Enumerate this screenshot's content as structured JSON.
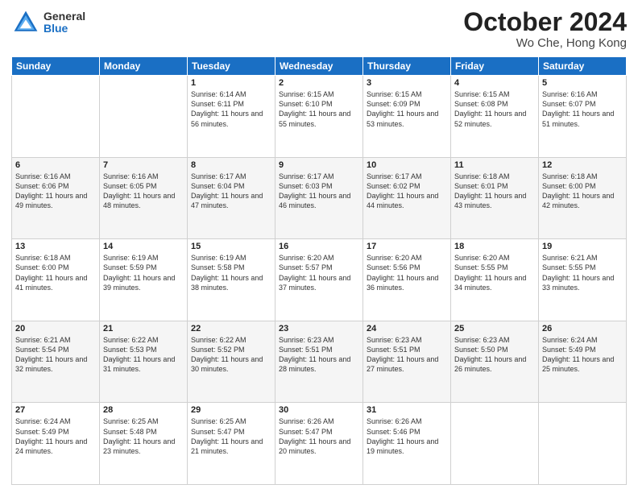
{
  "logo": {
    "general": "General",
    "blue": "Blue"
  },
  "title": {
    "month": "October 2024",
    "location": "Wo Che, Hong Kong"
  },
  "days_of_week": [
    "Sunday",
    "Monday",
    "Tuesday",
    "Wednesday",
    "Thursday",
    "Friday",
    "Saturday"
  ],
  "weeks": [
    [
      {
        "day": "",
        "info": ""
      },
      {
        "day": "",
        "info": ""
      },
      {
        "day": "1",
        "info": "Sunrise: 6:14 AM\nSunset: 6:11 PM\nDaylight: 11 hours and 56 minutes."
      },
      {
        "day": "2",
        "info": "Sunrise: 6:15 AM\nSunset: 6:10 PM\nDaylight: 11 hours and 55 minutes."
      },
      {
        "day": "3",
        "info": "Sunrise: 6:15 AM\nSunset: 6:09 PM\nDaylight: 11 hours and 53 minutes."
      },
      {
        "day": "4",
        "info": "Sunrise: 6:15 AM\nSunset: 6:08 PM\nDaylight: 11 hours and 52 minutes."
      },
      {
        "day": "5",
        "info": "Sunrise: 6:16 AM\nSunset: 6:07 PM\nDaylight: 11 hours and 51 minutes."
      }
    ],
    [
      {
        "day": "6",
        "info": "Sunrise: 6:16 AM\nSunset: 6:06 PM\nDaylight: 11 hours and 49 minutes."
      },
      {
        "day": "7",
        "info": "Sunrise: 6:16 AM\nSunset: 6:05 PM\nDaylight: 11 hours and 48 minutes."
      },
      {
        "day": "8",
        "info": "Sunrise: 6:17 AM\nSunset: 6:04 PM\nDaylight: 11 hours and 47 minutes."
      },
      {
        "day": "9",
        "info": "Sunrise: 6:17 AM\nSunset: 6:03 PM\nDaylight: 11 hours and 46 minutes."
      },
      {
        "day": "10",
        "info": "Sunrise: 6:17 AM\nSunset: 6:02 PM\nDaylight: 11 hours and 44 minutes."
      },
      {
        "day": "11",
        "info": "Sunrise: 6:18 AM\nSunset: 6:01 PM\nDaylight: 11 hours and 43 minutes."
      },
      {
        "day": "12",
        "info": "Sunrise: 6:18 AM\nSunset: 6:00 PM\nDaylight: 11 hours and 42 minutes."
      }
    ],
    [
      {
        "day": "13",
        "info": "Sunrise: 6:18 AM\nSunset: 6:00 PM\nDaylight: 11 hours and 41 minutes."
      },
      {
        "day": "14",
        "info": "Sunrise: 6:19 AM\nSunset: 5:59 PM\nDaylight: 11 hours and 39 minutes."
      },
      {
        "day": "15",
        "info": "Sunrise: 6:19 AM\nSunset: 5:58 PM\nDaylight: 11 hours and 38 minutes."
      },
      {
        "day": "16",
        "info": "Sunrise: 6:20 AM\nSunset: 5:57 PM\nDaylight: 11 hours and 37 minutes."
      },
      {
        "day": "17",
        "info": "Sunrise: 6:20 AM\nSunset: 5:56 PM\nDaylight: 11 hours and 36 minutes."
      },
      {
        "day": "18",
        "info": "Sunrise: 6:20 AM\nSunset: 5:55 PM\nDaylight: 11 hours and 34 minutes."
      },
      {
        "day": "19",
        "info": "Sunrise: 6:21 AM\nSunset: 5:55 PM\nDaylight: 11 hours and 33 minutes."
      }
    ],
    [
      {
        "day": "20",
        "info": "Sunrise: 6:21 AM\nSunset: 5:54 PM\nDaylight: 11 hours and 32 minutes."
      },
      {
        "day": "21",
        "info": "Sunrise: 6:22 AM\nSunset: 5:53 PM\nDaylight: 11 hours and 31 minutes."
      },
      {
        "day": "22",
        "info": "Sunrise: 6:22 AM\nSunset: 5:52 PM\nDaylight: 11 hours and 30 minutes."
      },
      {
        "day": "23",
        "info": "Sunrise: 6:23 AM\nSunset: 5:51 PM\nDaylight: 11 hours and 28 minutes."
      },
      {
        "day": "24",
        "info": "Sunrise: 6:23 AM\nSunset: 5:51 PM\nDaylight: 11 hours and 27 minutes."
      },
      {
        "day": "25",
        "info": "Sunrise: 6:23 AM\nSunset: 5:50 PM\nDaylight: 11 hours and 26 minutes."
      },
      {
        "day": "26",
        "info": "Sunrise: 6:24 AM\nSunset: 5:49 PM\nDaylight: 11 hours and 25 minutes."
      }
    ],
    [
      {
        "day": "27",
        "info": "Sunrise: 6:24 AM\nSunset: 5:49 PM\nDaylight: 11 hours and 24 minutes."
      },
      {
        "day": "28",
        "info": "Sunrise: 6:25 AM\nSunset: 5:48 PM\nDaylight: 11 hours and 23 minutes."
      },
      {
        "day": "29",
        "info": "Sunrise: 6:25 AM\nSunset: 5:47 PM\nDaylight: 11 hours and 21 minutes."
      },
      {
        "day": "30",
        "info": "Sunrise: 6:26 AM\nSunset: 5:47 PM\nDaylight: 11 hours and 20 minutes."
      },
      {
        "day": "31",
        "info": "Sunrise: 6:26 AM\nSunset: 5:46 PM\nDaylight: 11 hours and 19 minutes."
      },
      {
        "day": "",
        "info": ""
      },
      {
        "day": "",
        "info": ""
      }
    ]
  ]
}
